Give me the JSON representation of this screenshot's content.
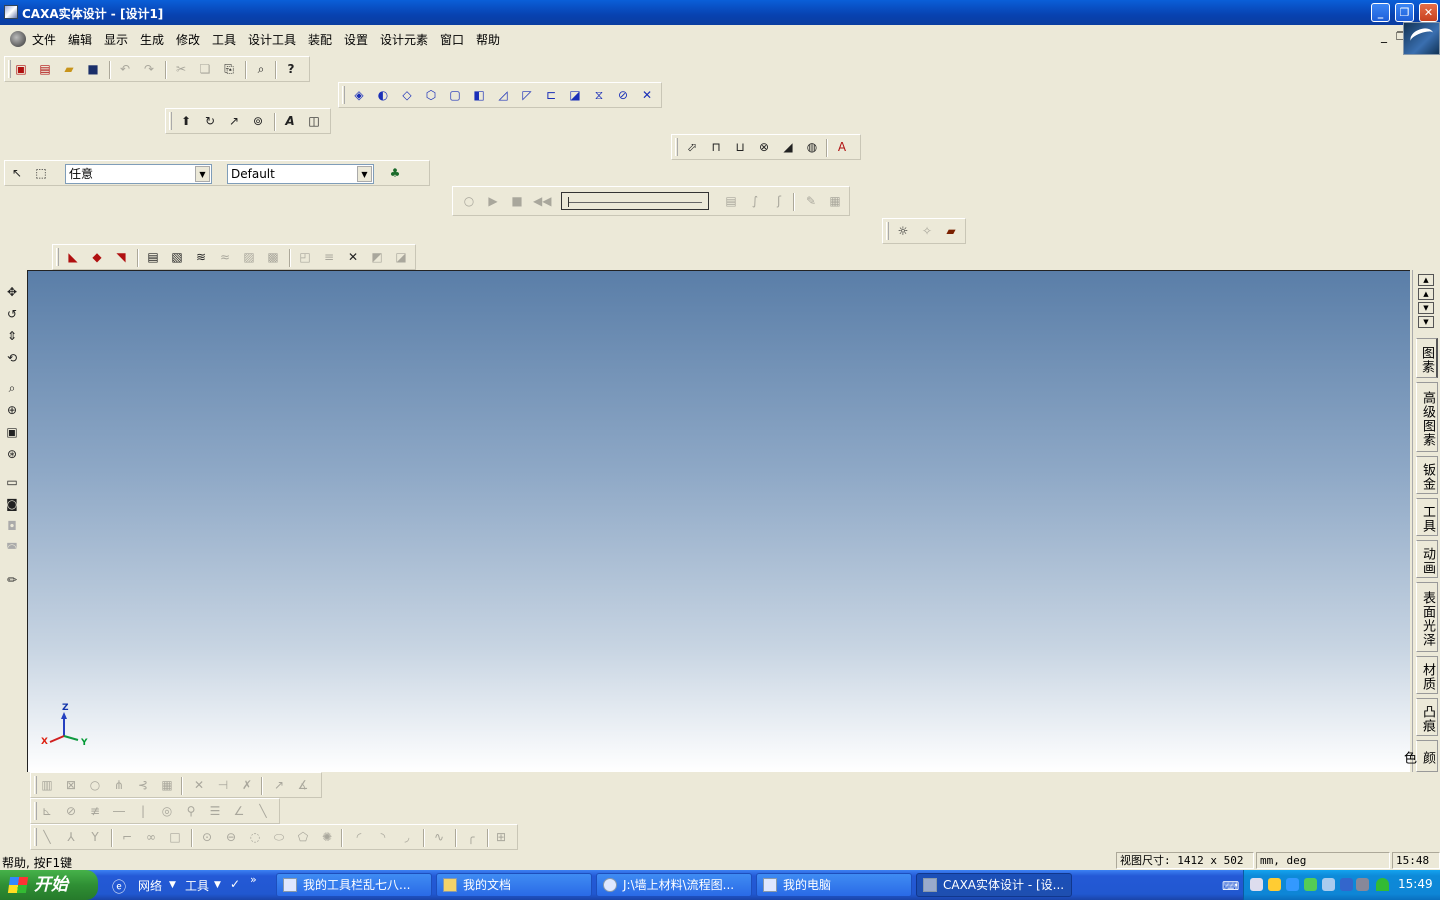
{
  "window": {
    "title": "CAXA实体设计 - [设计1]",
    "btn_min": "_",
    "btn_restore": "❐",
    "btn_close": "✕"
  },
  "menu": [
    "文件",
    "编辑",
    "显示",
    "生成",
    "修改",
    "工具",
    "设计工具",
    "装配",
    "设置",
    "设计元素",
    "窗口",
    "帮助"
  ],
  "selection": {
    "filter_value": "任意",
    "config_value": "Default"
  },
  "right_tabs": [
    "图素",
    "高级图素",
    "钣金",
    "工具",
    "动画",
    "表面光泽",
    "材质",
    "凸痕",
    "颜色"
  ],
  "axes": {
    "x": "X",
    "y": "Y",
    "z": "Z"
  },
  "status": {
    "help": "帮助, 按F1键",
    "view_label": "视图尺寸:",
    "view_w": "1412",
    "view_x": "x",
    "view_h": "502",
    "units": "mm, deg",
    "time": "15:48"
  },
  "taskbar": {
    "start": "开始",
    "quicklaunch": [
      "网络",
      "工具"
    ],
    "tasks": [
      "我的工具栏乱七八...",
      "我的文档",
      "J:\\墙上材料\\流程图...",
      "我的电脑",
      "CAXA实体设计 - [设..."
    ],
    "clock": "15:49"
  },
  "colors": {
    "title_blue": "#0842b0",
    "viewport_top": "#5a7ea8",
    "viewport_bottom": "#ffffff",
    "taskbar": "#2459d6",
    "start_green": "#2f8f34"
  }
}
